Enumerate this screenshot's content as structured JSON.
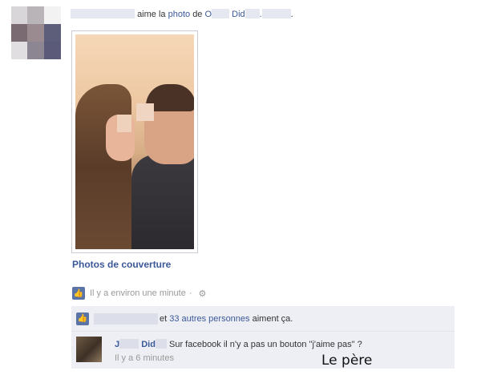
{
  "story": {
    "verb": "aime la",
    "photo_link": "photo",
    "preposition": "de",
    "owner_first": "O",
    "owner_last": "Did",
    "period": "."
  },
  "photo": {
    "caption": "Photos de couverture"
  },
  "meta": {
    "timestamp": "Il y a environ une minute",
    "separator": "·"
  },
  "likes": {
    "others_link": "33 autres personnes",
    "connector": "et",
    "suffix": "aiment ça."
  },
  "comment": {
    "author_first": "J",
    "author_last": "Did",
    "text": "Sur facebook il n'y a pas un bouton \"j'aime pas\" ?",
    "time": "Il y a 6 minutes"
  },
  "overlay": {
    "label": "Le père"
  },
  "colors": {
    "link": "#3b5998",
    "ufi_bg": "#edeff4",
    "meta_gray": "#999999"
  }
}
